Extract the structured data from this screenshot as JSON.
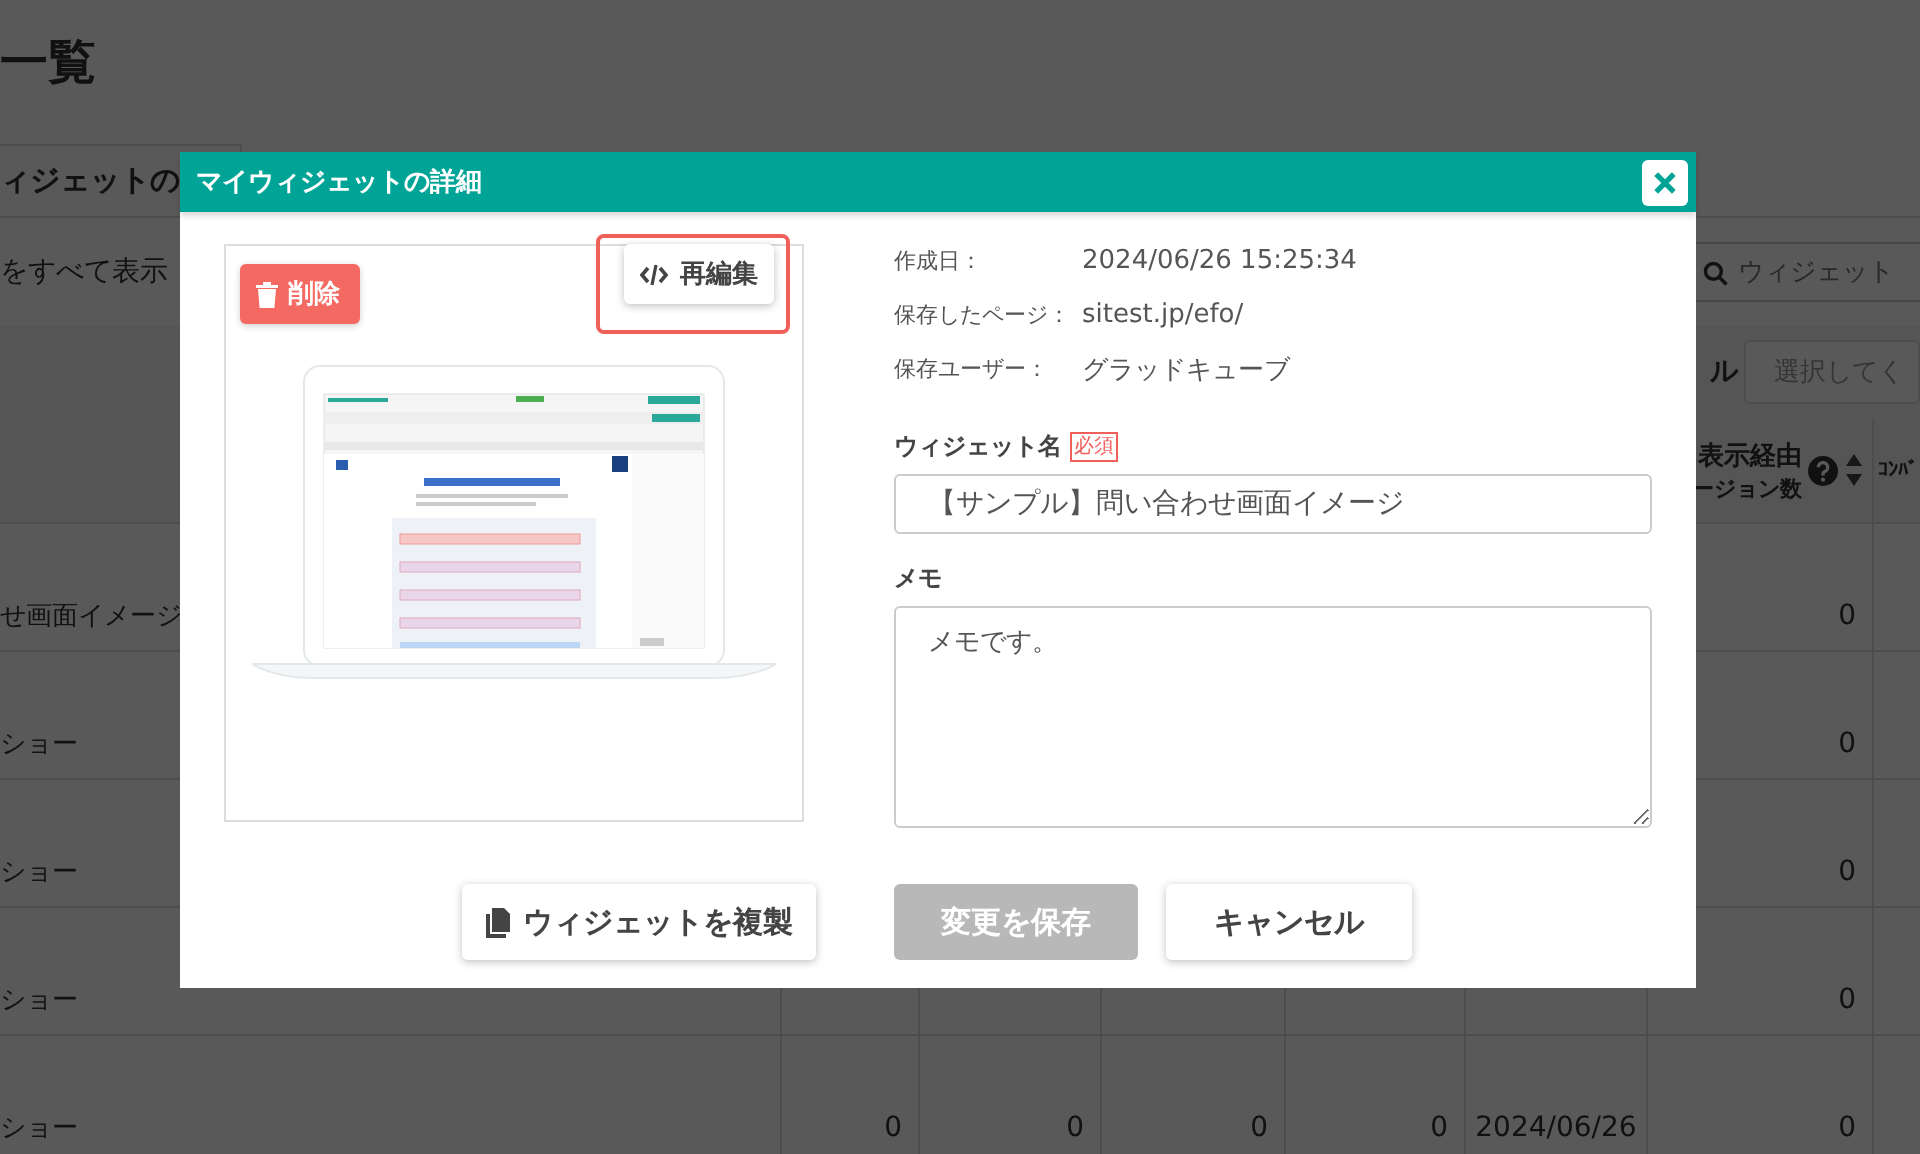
{
  "background_page": {
    "title": "一覧",
    "tab": "ィジェットの",
    "show_all_link": "をすべて表示",
    "search": {
      "placeholder": "ウィジェット"
    },
    "filter_label": "ル",
    "filter_select": {
      "placeholder": "選択してく"
    },
    "table": {
      "display_column": {
        "label_top": "表示経由",
        "label_bottom": "ージョン数"
      },
      "column_last": "ｺﾝﾊﾞ",
      "rows": [
        {
          "name": "せ画面イメージ",
          "cells": [
            null,
            null,
            null,
            null,
            null,
            "0"
          ]
        },
        {
          "name": "ショー",
          "cells": [
            null,
            null,
            null,
            null,
            null,
            "0"
          ]
        },
        {
          "name": "ショー",
          "cells": [
            null,
            null,
            null,
            null,
            null,
            "0"
          ]
        },
        {
          "name": "ショー",
          "cells": [
            null,
            null,
            null,
            null,
            null,
            "0"
          ]
        },
        {
          "name": "ショー",
          "cells": [
            "0",
            "0",
            "0",
            "0",
            "2024/06/26",
            "0"
          ]
        }
      ]
    }
  },
  "modal": {
    "title": "マイウィジェットの詳細",
    "delete_button": "削除",
    "reedit_button": {
      "label": "再編集",
      "highlighted": true
    },
    "info": [
      {
        "label": "作成日：",
        "value": "2024/06/26 15:25:34"
      },
      {
        "label": "保存したページ：",
        "value": "sitest.jp/efo/"
      },
      {
        "label": "保存ユーザー：",
        "value": "グラッドキューブ"
      }
    ],
    "name_field": {
      "label": "ウィジェット名",
      "required_badge": "必須",
      "value": "【サンプル】問い合わせ画面イメージ"
    },
    "memo_field": {
      "label": "メモ",
      "value": "メモです。"
    },
    "buttons": [
      {
        "label": "ウィジェットを複製",
        "kind": "duplicate",
        "disabled": false
      },
      {
        "label": "変更を保存",
        "kind": "save",
        "disabled": true
      },
      {
        "label": "キャンセル",
        "kind": "cancel",
        "disabled": false
      }
    ]
  }
}
